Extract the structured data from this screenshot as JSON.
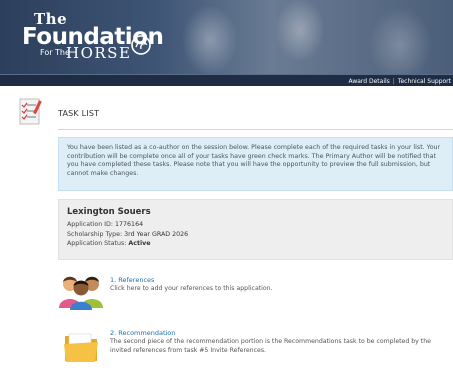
{
  "header": {
    "logo_the": "The",
    "logo_main": "Foundation",
    "logo_for_the": "For The",
    "logo_horse": "HORSE",
    "nav": [
      "Award Details",
      "Technical Support"
    ]
  },
  "task_list": {
    "title": "TASK LIST",
    "info": "You have been listed as a co-author on the session below. Please complete each of the required tasks in your list. Your contribution will be complete once all of your tasks have green check marks. The Primary Author will be notified that you have completed these tasks. Please note that you will have the opportunity to preview the full submission, but cannot make changes."
  },
  "applicant": {
    "name": "Lexington Souers",
    "id_label": "Application ID:",
    "id_value": "1776164",
    "type_label": "Scholarship Type:",
    "type_value": "3rd Year GRAD 2026",
    "status_label": "Application Status:",
    "status_value": "Active"
  },
  "tasks": [
    {
      "number": "1.",
      "title": "References",
      "description": "Click here to add your references to this application.",
      "icon": "people-icon"
    },
    {
      "number": "2.",
      "title": "Recommendation",
      "description": "The second piece of the recommendation portion is the Recommendations task to be completed by the invited references from task #5 Invite References.",
      "icon": "folder-icon"
    }
  ],
  "colors": {
    "banner_dark": "#2c3f5c",
    "navbar": "#1e2c44",
    "link": "#1a6fb0",
    "info_bg": "#ddeef7",
    "applicant_bg": "#eeeeee"
  }
}
